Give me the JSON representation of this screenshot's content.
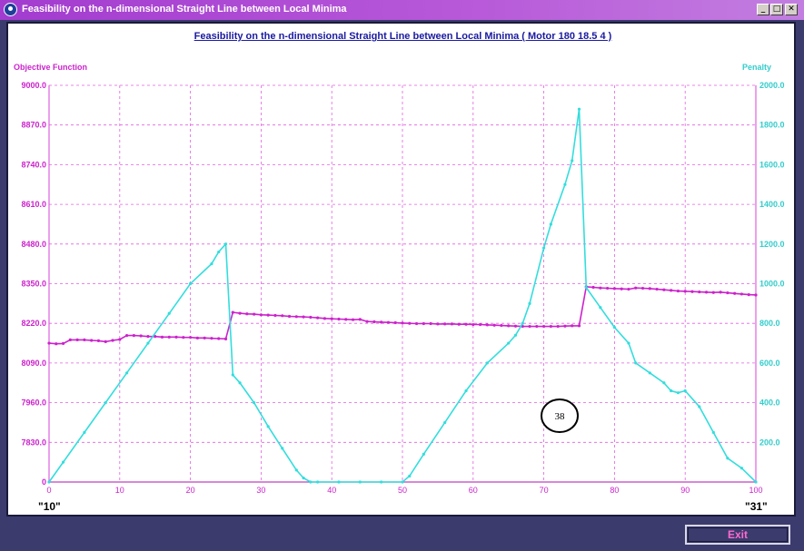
{
  "window": {
    "title": "Feasibility on the n-dimensional Straight Line between Local Minima",
    "minimize_glyph": "_",
    "maximize_glyph": "□",
    "close_glyph": "✕"
  },
  "buttons": {
    "exit_label": "Exit"
  },
  "colors": {
    "objective": "#cc22cc",
    "penalty": "#33dddd",
    "grid": "#e060e0",
    "title": "#1a1aa0"
  },
  "chart_data": {
    "type": "line",
    "title": "Feasibility on the n-dimensional Straight Line between Local Minima  ( Motor 180  18.5  4 )",
    "ylabel_left": "Objective Function",
    "ylabel_right": "Penalty",
    "x_start_label": "\"10\"",
    "x_end_label": "\"31\"",
    "annotation": "38",
    "xlim": [
      0,
      100
    ],
    "ylim_left": [
      7700,
      9000
    ],
    "ylim_right": [
      0,
      2000
    ],
    "xticks": [
      0,
      10,
      20,
      30,
      40,
      50,
      60,
      70,
      80,
      90,
      100
    ],
    "yticks_left": [
      {
        "value": 7700,
        "label": "0"
      },
      {
        "value": 7830,
        "label": "7830.0"
      },
      {
        "value": 7960,
        "label": "7960.0"
      },
      {
        "value": 8090,
        "label": "8090.0"
      },
      {
        "value": 8220,
        "label": "8220.0"
      },
      {
        "value": 8350,
        "label": "8350.0"
      },
      {
        "value": 8480,
        "label": "8480.0"
      },
      {
        "value": 8610,
        "label": "8610.0"
      },
      {
        "value": 8740,
        "label": "8740.0"
      },
      {
        "value": 8870,
        "label": "8870.0"
      },
      {
        "value": 9000,
        "label": "9000.0"
      }
    ],
    "yticks_right": [
      {
        "value": 200,
        "label": "200.0"
      },
      {
        "value": 400,
        "label": "400.0"
      },
      {
        "value": 600,
        "label": "600.0"
      },
      {
        "value": 800,
        "label": "800.0"
      },
      {
        "value": 1000,
        "label": "1000.0"
      },
      {
        "value": 1200,
        "label": "1200.0"
      },
      {
        "value": 1400,
        "label": "1400.0"
      },
      {
        "value": 1600,
        "label": "1600.0"
      },
      {
        "value": 1800,
        "label": "1800.0"
      },
      {
        "value": 2000,
        "label": "2000.0"
      }
    ],
    "grid": true,
    "series": [
      {
        "name": "Objective Function",
        "axis": "left",
        "x": [
          0,
          1,
          2,
          3,
          4,
          5,
          6,
          7,
          8,
          9,
          10,
          11,
          12,
          13,
          14,
          15,
          16,
          17,
          18,
          19,
          20,
          21,
          22,
          23,
          24,
          25,
          26,
          27,
          28,
          29,
          30,
          31,
          32,
          33,
          34,
          35,
          36,
          37,
          38,
          39,
          40,
          41,
          42,
          43,
          44,
          45,
          46,
          47,
          48,
          49,
          50,
          51,
          52,
          53,
          54,
          55,
          56,
          57,
          58,
          59,
          60,
          61,
          62,
          63,
          64,
          65,
          66,
          67,
          68,
          69,
          70,
          71,
          72,
          73,
          74,
          75,
          76,
          77,
          78,
          79,
          80,
          81,
          82,
          83,
          84,
          85,
          86,
          87,
          88,
          89,
          90,
          91,
          92,
          93,
          94,
          95,
          96,
          97,
          98,
          99,
          100
        ],
        "y": [
          8155,
          8153,
          8154,
          8166,
          8166,
          8166,
          8164,
          8163,
          8160,
          8164,
          8167,
          8180,
          8180,
          8179,
          8177,
          8177,
          8175,
          8175,
          8175,
          8174,
          8174,
          8172,
          8172,
          8171,
          8170,
          8169,
          8256,
          8253,
          8251,
          8250,
          8248,
          8247,
          8246,
          8245,
          8243,
          8242,
          8241,
          8240,
          8238,
          8236,
          8235,
          8234,
          8233,
          8232,
          8233,
          8226,
          8225,
          8224,
          8223,
          8222,
          8221,
          8220,
          8219,
          8219,
          8219,
          8218,
          8218,
          8218,
          8217,
          8217,
          8216,
          8216,
          8215,
          8214,
          8213,
          8212,
          8211,
          8210,
          8210,
          8210,
          8210,
          8210,
          8210,
          8211,
          8212,
          8212,
          8340,
          8338,
          8336,
          8335,
          8334,
          8333,
          8332,
          8336,
          8335,
          8334,
          8332,
          8330,
          8328,
          8326,
          8325,
          8324,
          8323,
          8322,
          8321,
          8322,
          8320,
          8318,
          8316,
          8314,
          8313
        ]
      },
      {
        "name": "Penalty",
        "axis": "right",
        "x": [
          0,
          2,
          5,
          8,
          11,
          14,
          17,
          20,
          23,
          24,
          25,
          26,
          27,
          29,
          31,
          33,
          35,
          36,
          37,
          38,
          41,
          44,
          47,
          50,
          51,
          53,
          56,
          59,
          62,
          65,
          66,
          67,
          68,
          70,
          71,
          73,
          74,
          75,
          76,
          78,
          80,
          82,
          83,
          85,
          87,
          88,
          89,
          90,
          92,
          94,
          96,
          98,
          100
        ],
        "y": [
          0,
          100,
          250,
          400,
          550,
          700,
          850,
          1000,
          1100,
          1160,
          1200,
          540,
          500,
          400,
          280,
          170,
          60,
          20,
          0,
          0,
          0,
          0,
          0,
          0,
          30,
          140,
          300,
          460,
          600,
          700,
          740,
          800,
          900,
          1180,
          1300,
          1500,
          1620,
          1880,
          980,
          880,
          780,
          700,
          600,
          550,
          500,
          460,
          450,
          460,
          380,
          250,
          120,
          70,
          0
        ]
      }
    ]
  }
}
